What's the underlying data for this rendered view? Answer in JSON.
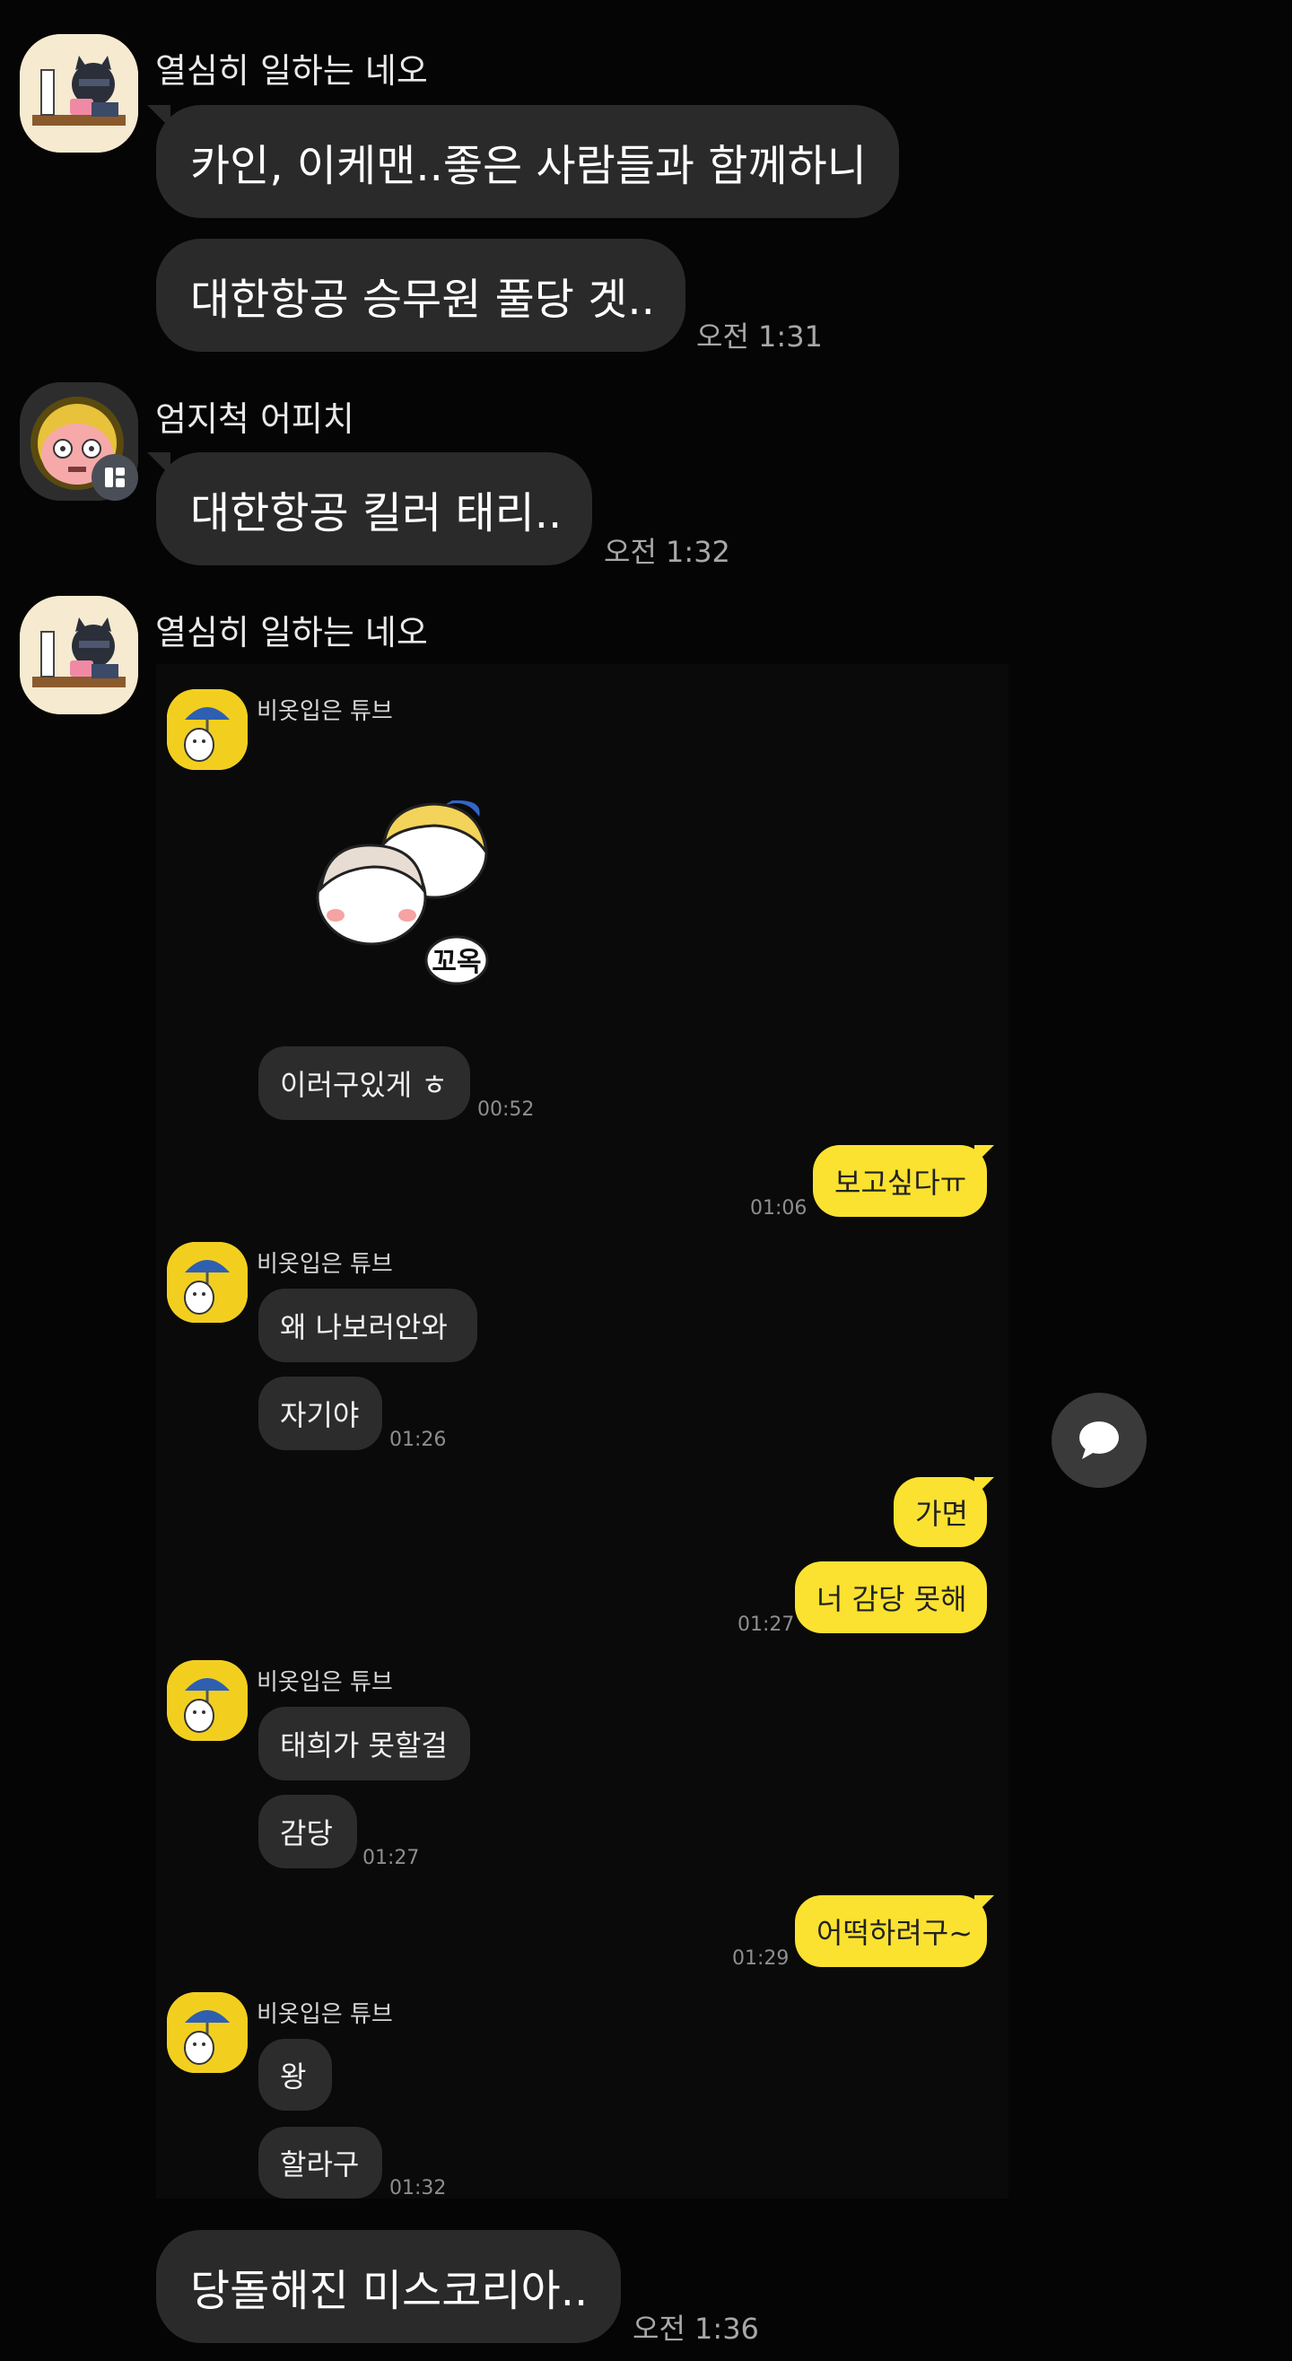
{
  "messages": [
    {
      "sender": "열심히 일하는 네오",
      "text": "카인, 이케맨..좋은 사람들과 함께하니"
    },
    {
      "text": "대한항공 승무원 풀당 겟..",
      "time": "오전 1:31"
    },
    {
      "sender": "엄지척 어피치",
      "text": "대한항공 킬러 태리..",
      "time": "오전 1:32"
    },
    {
      "sender": "열심히 일하는 네오"
    },
    {
      "text": "당돌해진 미스코리아..",
      "time": "오전 1:36"
    }
  ],
  "embedded": {
    "sender": "비옷입은 튜브",
    "sticker_text": "꼬옥",
    "chat": [
      {
        "side": "left",
        "text": "이러구있게 ㅎ",
        "time": "00:52"
      },
      {
        "side": "right",
        "text": "보고싶다ㅠ",
        "time": "01:06"
      },
      {
        "side": "left",
        "text": "왜 나보러안와"
      },
      {
        "side": "left",
        "text": "자기야",
        "time": "01:26"
      },
      {
        "side": "right",
        "text": "가면"
      },
      {
        "side": "right",
        "text": "너 감당 못해",
        "time": "01:27"
      },
      {
        "side": "left",
        "text": "태희가 못할걸"
      },
      {
        "side": "left",
        "text": "감당",
        "time": "01:27"
      },
      {
        "side": "right",
        "text": "어떡하려구~",
        "time": "01:29"
      },
      {
        "side": "left",
        "text": "왕"
      },
      {
        "side": "left",
        "text": "할라구",
        "time": "01:32"
      }
    ]
  },
  "icons": {
    "fab": "chat-bubble-icon",
    "neo": "neo-avatar",
    "apeach": "apeach-avatar",
    "tube": "tube-avatar",
    "badge": "home-badge-icon"
  },
  "colors": {
    "background": "#050505",
    "bubble_dark": "#2a2a2a",
    "bubble_yellow": "#fbe230"
  }
}
